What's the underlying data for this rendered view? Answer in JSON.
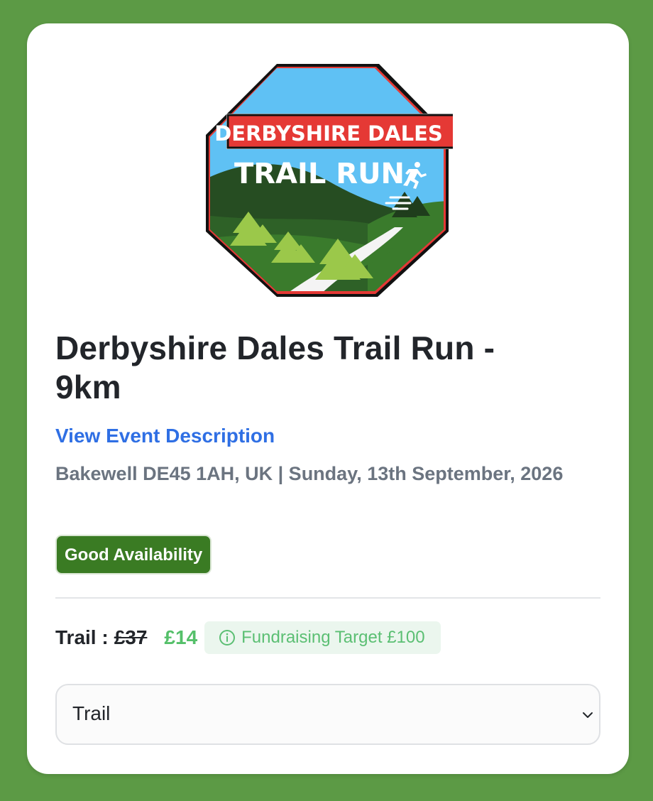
{
  "logo": {
    "line1": "DERBYSHIRE DALES",
    "line2": "TRAIL RUN",
    "colors": {
      "sky": "#5fc1f4",
      "red": "#e53935",
      "dark_hill": "#264d22",
      "green_hill": "#3a7b2c",
      "tree": "#9bc84a"
    }
  },
  "event": {
    "title": "Derbyshire Dales Trail Run - 9km",
    "description_link": "View Event Description",
    "location_date": "Bakewell DE45 1AH, UK | Sunday, 13th September, 2026",
    "availability": "Good Availability"
  },
  "pricing": {
    "label": "Trail :",
    "old_price": "£37",
    "new_price": "£14",
    "fundraising": "Fundraising Target £100",
    "icon": "info-icon"
  },
  "select": {
    "value": "Trail",
    "icon": "chevron-down-icon"
  },
  "colors": {
    "background": "#5c9a45",
    "link": "#2f6fe4",
    "badge": "#3a7b23",
    "price_green": "#55c06a"
  }
}
